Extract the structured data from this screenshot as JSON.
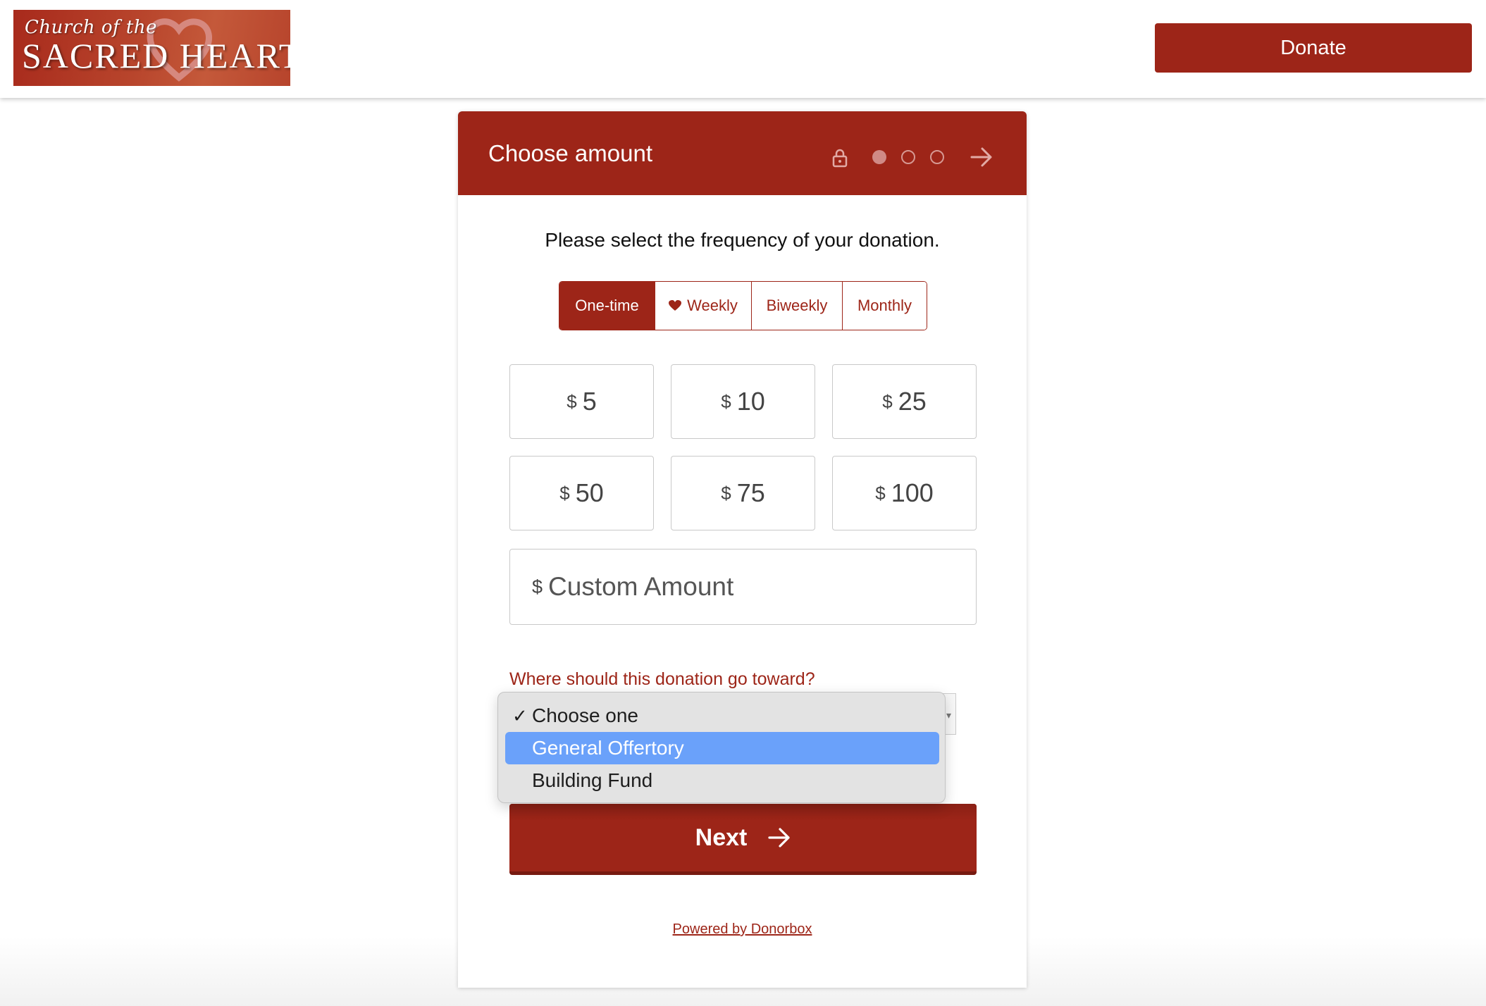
{
  "header": {
    "logo": {
      "script_text": "Church of the",
      "main_text": "SACRED HEART"
    },
    "donate_label": "Donate"
  },
  "colors": {
    "brand": "#9d2518",
    "highlight": "#6aa1fa"
  },
  "form": {
    "title": "Choose amount",
    "steps": {
      "current": 1,
      "total": 3
    },
    "icons": {
      "secure": "lock-icon",
      "next_step": "arrow-right-icon"
    },
    "prompt": "Please select the frequency of your donation.",
    "frequencies": [
      {
        "label": "One-time",
        "active": true,
        "icon": ""
      },
      {
        "label": "Weekly",
        "active": false,
        "icon": "heart-icon"
      },
      {
        "label": "Biweekly",
        "active": false,
        "icon": ""
      },
      {
        "label": "Monthly",
        "active": false,
        "icon": ""
      }
    ],
    "currency_symbol": "$",
    "amounts": [
      "5",
      "10",
      "25",
      "50",
      "75",
      "100"
    ],
    "custom_amount_placeholder": "Custom Amount",
    "destination": {
      "label": "Where should this donation go toward?",
      "selected": "Choose one",
      "options": [
        {
          "label": "Choose one",
          "checked": true,
          "highlighted": false
        },
        {
          "label": "General Offertory",
          "checked": false,
          "highlighted": true
        },
        {
          "label": "Building Fund",
          "checked": false,
          "highlighted": false
        }
      ]
    },
    "next_label": "Next",
    "powered_by": "Powered by Donorbox"
  }
}
